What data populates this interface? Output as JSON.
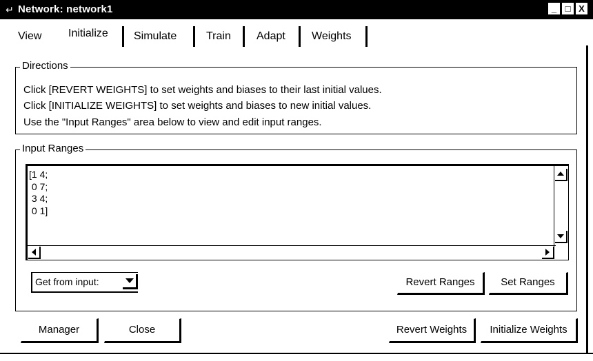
{
  "window": {
    "title": "Network: network1",
    "controls": {
      "minimize": "_",
      "maximize": "□",
      "close": "X"
    }
  },
  "tabs": [
    "View",
    "Initialize",
    "Simulate",
    "Train",
    "Adapt",
    "Weights"
  ],
  "active_tab": "Initialize",
  "directions": {
    "legend": "Directions",
    "lines": [
      "Click [REVERT WEIGHTS] to set weights and biases to their last initial values.",
      "Click [INITIALIZE WEIGHTS] to set weights and biases to new initial values.",
      "Use the \"Input Ranges\" area below to view and edit input ranges."
    ]
  },
  "input_ranges": {
    "legend": "Input Ranges",
    "text": "[1 4;\n 0 7;\n 3 4;\n 0 1]",
    "source_select": "Get from input:",
    "revert_ranges_label": "Revert Ranges",
    "set_ranges_label": "Set Ranges"
  },
  "footer": {
    "manager_label": "Manager",
    "close_label": "Close",
    "revert_weights_label": "Revert Weights",
    "initialize_weights_label": "Initialize Weights"
  }
}
